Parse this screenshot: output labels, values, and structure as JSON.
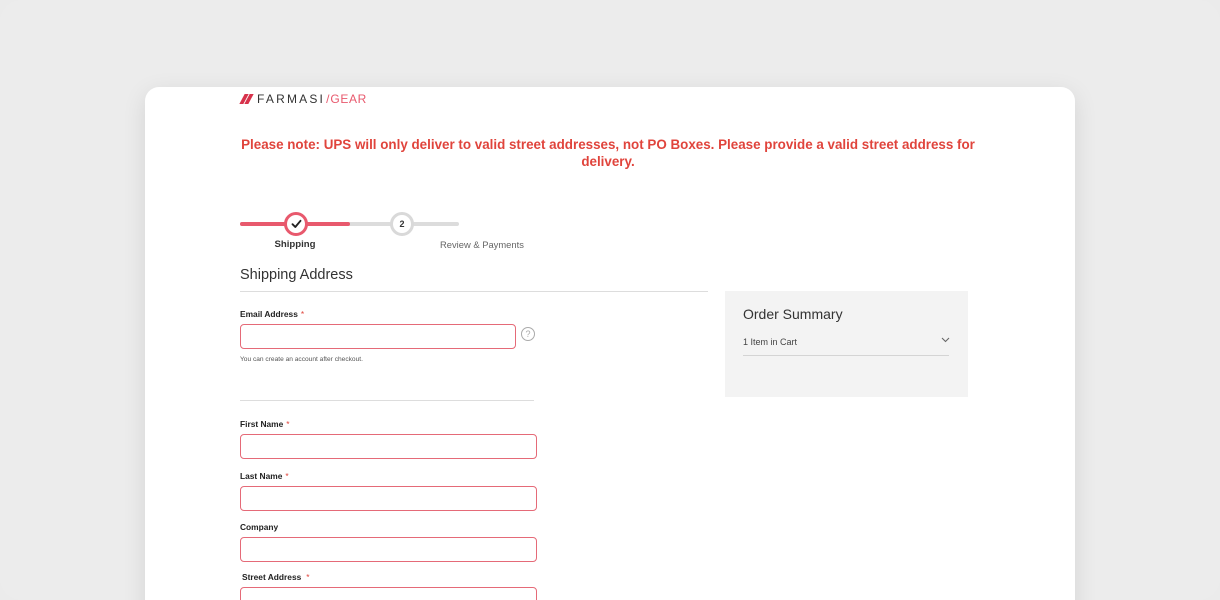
{
  "brand": {
    "name": "FARMASI",
    "slash": "/",
    "sub": "GEAR"
  },
  "notice": "Please note: UPS will only deliver to valid street addresses, not PO Boxes. Please provide a valid street address for delivery.",
  "progress": {
    "steps": [
      {
        "number": "",
        "label": "Shipping",
        "state": "completed"
      },
      {
        "number": "2",
        "label": "Review & Payments",
        "state": "pending"
      }
    ]
  },
  "shipping": {
    "title": "Shipping Address",
    "required_marker": "*",
    "email": {
      "label": "Email Address",
      "value": "",
      "placeholder": "",
      "hint": "You can create an account after checkout."
    },
    "first_name": {
      "label": "First Name",
      "value": ""
    },
    "last_name": {
      "label": "Last Name",
      "value": ""
    },
    "company": {
      "label": "Company",
      "value": ""
    },
    "street": {
      "label": "Street Address",
      "value": ""
    }
  },
  "summary": {
    "title": "Order Summary",
    "items_in_cart": "1 Item in Cart"
  },
  "colors": {
    "accent": "#e8596d",
    "notice": "#e0443c",
    "brand_mark": "#d7324b"
  },
  "icons": {
    "step_complete": "check-icon",
    "help": "question-circle-icon",
    "expand": "chevron-down-icon"
  }
}
